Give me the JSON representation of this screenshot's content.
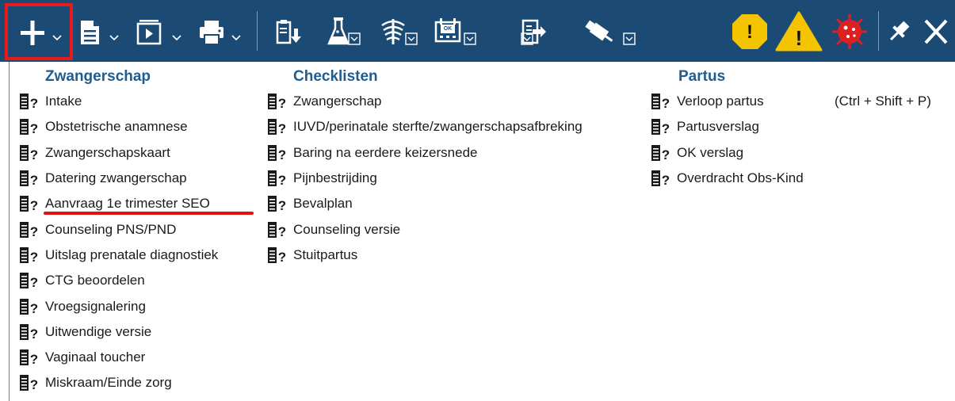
{
  "toolbar": {
    "buttons": [
      {
        "name": "new-button",
        "icon": "plus-icon",
        "has_dropdown": true
      },
      {
        "name": "document-button",
        "icon": "document-icon",
        "has_dropdown": true
      },
      {
        "name": "media-button",
        "icon": "media-play-icon",
        "has_dropdown": true
      },
      {
        "name": "print-button",
        "icon": "printer-icon",
        "has_dropdown": true
      },
      {
        "name": "clipboard-button",
        "icon": "clipboard-download-icon",
        "has_dropdown": false
      },
      {
        "name": "lab-button",
        "icon": "flask-icon",
        "has_checkbox": true
      },
      {
        "name": "vitals-button",
        "icon": "wave-icon",
        "has_checkbox": true
      },
      {
        "name": "ok-calendar-button",
        "icon": "calendar-ok-icon",
        "has_checkbox": true
      },
      {
        "name": "export-button",
        "icon": "export-icon",
        "has_checkbox": true
      },
      {
        "name": "injection-button",
        "icon": "syringe-icon",
        "has_checkbox": true
      }
    ],
    "calendar_badge": "OK",
    "alerts": [
      {
        "name": "info-alert",
        "icon": "octagon-alert-icon",
        "glyph": "!",
        "color": "#f5c400"
      },
      {
        "name": "warning-alert",
        "icon": "triangle-warning-icon",
        "glyph": "!",
        "color": "#f5c400"
      },
      {
        "name": "virus-alert",
        "icon": "virus-icon",
        "color": "#e02020"
      }
    ],
    "accent": "#1b4a74",
    "highlight_color": "#e81b1b"
  },
  "menu": {
    "columns": [
      {
        "header": "Zwangerschap",
        "items": [
          {
            "label": "Intake"
          },
          {
            "label": "Obstetrische anamnese"
          },
          {
            "label": "Zwangerschapskaart"
          },
          {
            "label": "Datering zwangerschap"
          },
          {
            "label": "Aanvraag 1e trimester SEO",
            "underlined": true
          },
          {
            "label": "Counseling PNS/PND"
          },
          {
            "label": "Uitslag prenatale diagnostiek"
          },
          {
            "label": "CTG beoordelen"
          },
          {
            "label": "Vroegsignalering"
          },
          {
            "label": "Uitwendige versie"
          },
          {
            "label": "Vaginaal toucher"
          },
          {
            "label": "Miskraam/Einde zorg"
          }
        ]
      },
      {
        "header": "Checklisten",
        "items": [
          {
            "label": "Zwangerschap"
          },
          {
            "label": "IUVD/perinatale sterfte/zwangerschapsafbreking"
          },
          {
            "label": "Baring na eerdere keizersnede"
          },
          {
            "label": "Pijnbestrijding"
          },
          {
            "label": "Bevalplan"
          },
          {
            "label": "Counseling versie"
          },
          {
            "label": "Stuitpartus"
          }
        ]
      },
      {
        "header": "Partus",
        "items": [
          {
            "label": "Verloop partus",
            "shortcut": "(Ctrl + Shift + P)"
          },
          {
            "label": "Partusverslag"
          },
          {
            "label": "OK verslag"
          },
          {
            "label": "Overdracht Obs-Kind"
          }
        ]
      }
    ],
    "item_icon": "document-question-icon",
    "underline_color": "#e31010"
  }
}
